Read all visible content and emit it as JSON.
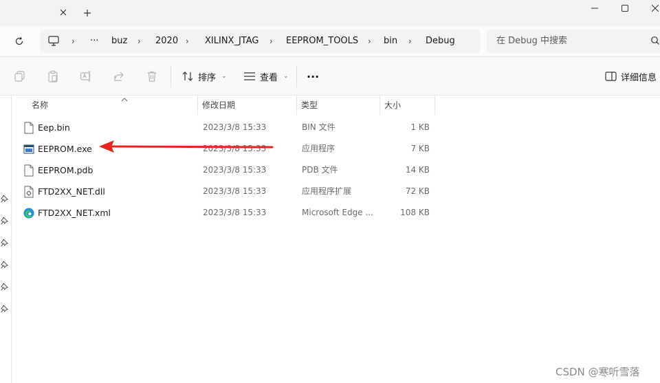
{
  "breadcrumb": {
    "items": [
      "buz",
      "2020",
      "XILINX_JTAG",
      "EEPROM_TOOLS",
      "bin",
      "Debug"
    ],
    "overflow": "···"
  },
  "search": {
    "placeholder": "在 Debug 中搜索"
  },
  "toolbar": {
    "sort_label": "排序",
    "view_label": "查看",
    "more_label": "···",
    "details_label": "详细信息"
  },
  "columns": {
    "name": "名称",
    "modified": "修改日期",
    "type": "类型",
    "size": "大小"
  },
  "files": [
    {
      "name": "Eep.bin",
      "modified": "2023/3/8 15:33",
      "type": "BIN 文件",
      "size": "1 KB",
      "icon": "file-icon"
    },
    {
      "name": "EEPROM.exe",
      "modified": "2023/3/8 15:33",
      "type": "应用程序",
      "size": "7 KB",
      "icon": "exe-icon"
    },
    {
      "name": "EEPROM.pdb",
      "modified": "2023/3/8 15:33",
      "type": "PDB 文件",
      "size": "14 KB",
      "icon": "file-icon"
    },
    {
      "name": "FTD2XX_NET.dll",
      "modified": "2023/3/8 15:33",
      "type": "应用程序扩展",
      "size": "72 KB",
      "icon": "dll-icon"
    },
    {
      "name": "FTD2XX_NET.xml",
      "modified": "2023/3/8 15:33",
      "type": "Microsoft Edge ...",
      "size": "108 KB",
      "icon": "edge-icon"
    }
  ],
  "watermark": "CSDN @寒听雪落",
  "colors": {
    "annotation_arrow": "#e8221c",
    "accent": "#0067c0"
  }
}
